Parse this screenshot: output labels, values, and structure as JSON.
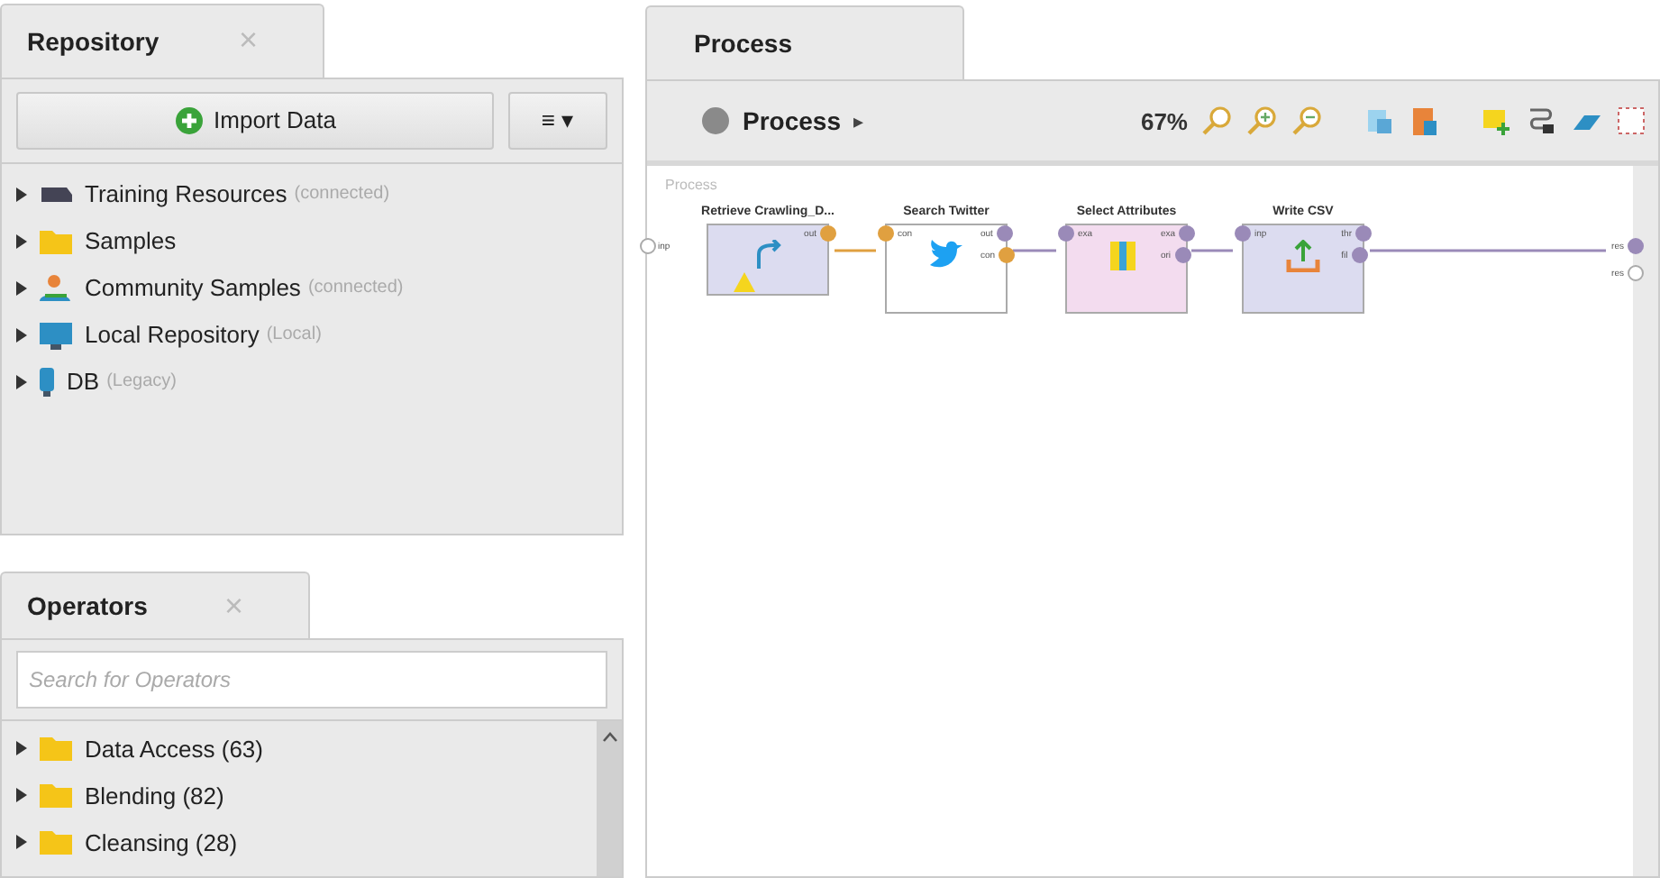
{
  "repository": {
    "tab": {
      "label": "Repository",
      "close": "×"
    },
    "import_button": "Import Data",
    "menu_button": "≡ ▾",
    "items": [
      {
        "kind": "cloud",
        "name": "Training Resources",
        "note": "(connected)"
      },
      {
        "kind": "folder",
        "name": "Samples"
      },
      {
        "kind": "people",
        "name": "Community Samples",
        "note": "(connected)"
      },
      {
        "kind": "monitor",
        "name": "Local Repository",
        "note": "(Local)"
      },
      {
        "kind": "db",
        "name": "DB",
        "note": "(Legacy)"
      }
    ]
  },
  "operators": {
    "tab": {
      "label": "Operators",
      "close": "×"
    },
    "search": {
      "placeholder": "Search for Operators"
    },
    "items": [
      {
        "name": "Data Access (63)"
      },
      {
        "name": "Blending (82)"
      },
      {
        "name": "Cleansing (28)"
      }
    ]
  },
  "process": {
    "tab": "Process",
    "breadcrumb": "Process",
    "breadcrumb_arrow": "▸",
    "zoom": "67%",
    "canvas_label": "Process",
    "input_port": "inp",
    "output_ports": [
      "res",
      "res"
    ],
    "nodes": [
      {
        "kind": "retrieve",
        "title": "Retrieve Crawling_D...",
        "warning": true,
        "outputs": [
          "out"
        ]
      },
      {
        "kind": "twitter",
        "title": "Search Twitter",
        "warning": false,
        "inputs": [
          "con"
        ],
        "outputs": [
          "out",
          "con"
        ]
      },
      {
        "kind": "select",
        "title": "Select Attributes",
        "warning": false,
        "inputs": [
          "exa"
        ],
        "outputs": [
          "exa",
          "ori"
        ]
      },
      {
        "kind": "write",
        "title": "Write CSV",
        "warning": false,
        "inputs": [
          "inp"
        ],
        "outputs": [
          "thr",
          "fil"
        ]
      }
    ]
  }
}
